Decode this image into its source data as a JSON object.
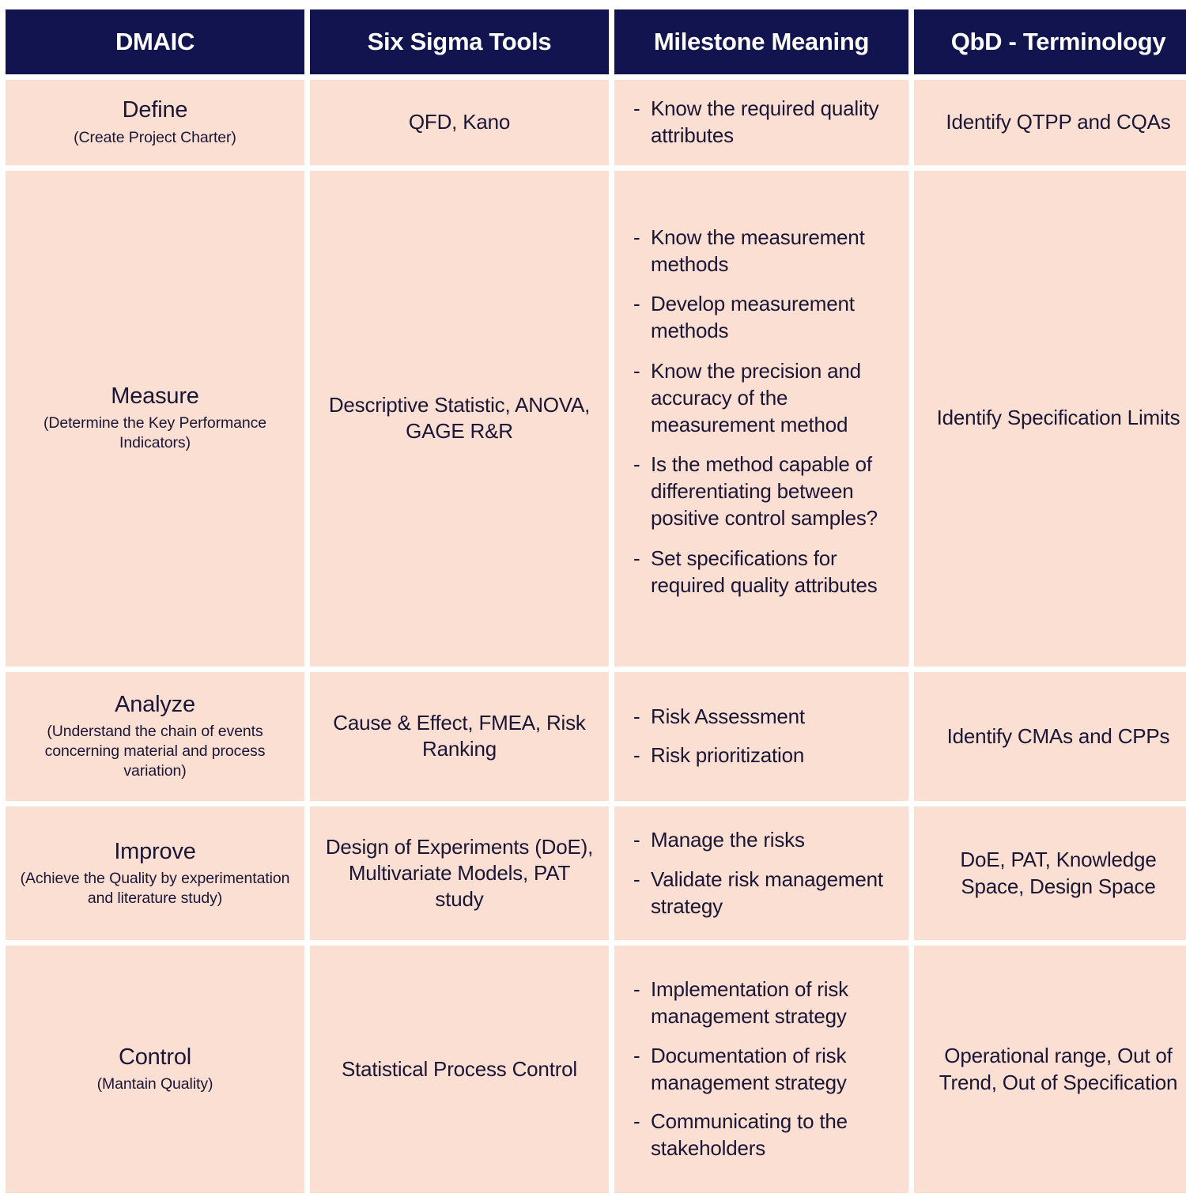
{
  "table": {
    "columns": [
      {
        "id": "dmaic",
        "label": "DMAIC"
      },
      {
        "id": "tools",
        "label": "Six Sigma Tools"
      },
      {
        "id": "milestone",
        "label": "Milestone Meaning"
      },
      {
        "id": "qbd",
        "label": "QbD - Terminology"
      }
    ],
    "colors": {
      "header_background": "#121450",
      "header_text": "#ffffff",
      "cell_background": "#fbdfd2",
      "cell_text": "#1b1536",
      "page_background": "#ffffff"
    },
    "rows": [
      {
        "phase": "Define",
        "phase_note": "(Create Project Charter)",
        "tools": "QFD, Kano",
        "milestones": [
          "Know the required quality attributes"
        ],
        "qbd": "Identify QTPP and CQAs"
      },
      {
        "phase": "Measure",
        "phase_note": "(Determine the Key Performance Indicators)",
        "tools": "Descriptive Statistic, ANOVA, GAGE R&R",
        "milestones": [
          "Know the measurement methods",
          "Develop measurement methods",
          "Know the precision and accuracy of the measurement method",
          "Is the method capable of differentiating between positive control samples?",
          "Set specifications for required quality attributes"
        ],
        "qbd": "Identify Specification Limits"
      },
      {
        "phase": "Analyze",
        "phase_note": "(Understand the chain of events concerning material and process variation)",
        "tools": "Cause & Effect, FMEA, Risk Ranking",
        "milestones": [
          "Risk Assessment",
          "Risk prioritization"
        ],
        "qbd": "Identify CMAs and CPPs"
      },
      {
        "phase": "Improve",
        "phase_note": "(Achieve the Quality by experimentation and literature study)",
        "tools": "Design of Experiments (DoE), Multivariate Models, PAT study",
        "milestones": [
          "Manage the risks",
          "Validate risk management strategy"
        ],
        "qbd": "DoE, PAT, Knowledge Space, Design Space"
      },
      {
        "phase": "Control",
        "phase_note": "(Mantain Quality)",
        "tools": "Statistical Process Control",
        "milestones": [
          "Implementation of risk management strategy",
          "Documentation of risk management strategy",
          "Communicating to the stakeholders"
        ],
        "qbd": "Operational range, Out of Trend, Out of Specification"
      }
    ],
    "bullet_marker": "-"
  }
}
